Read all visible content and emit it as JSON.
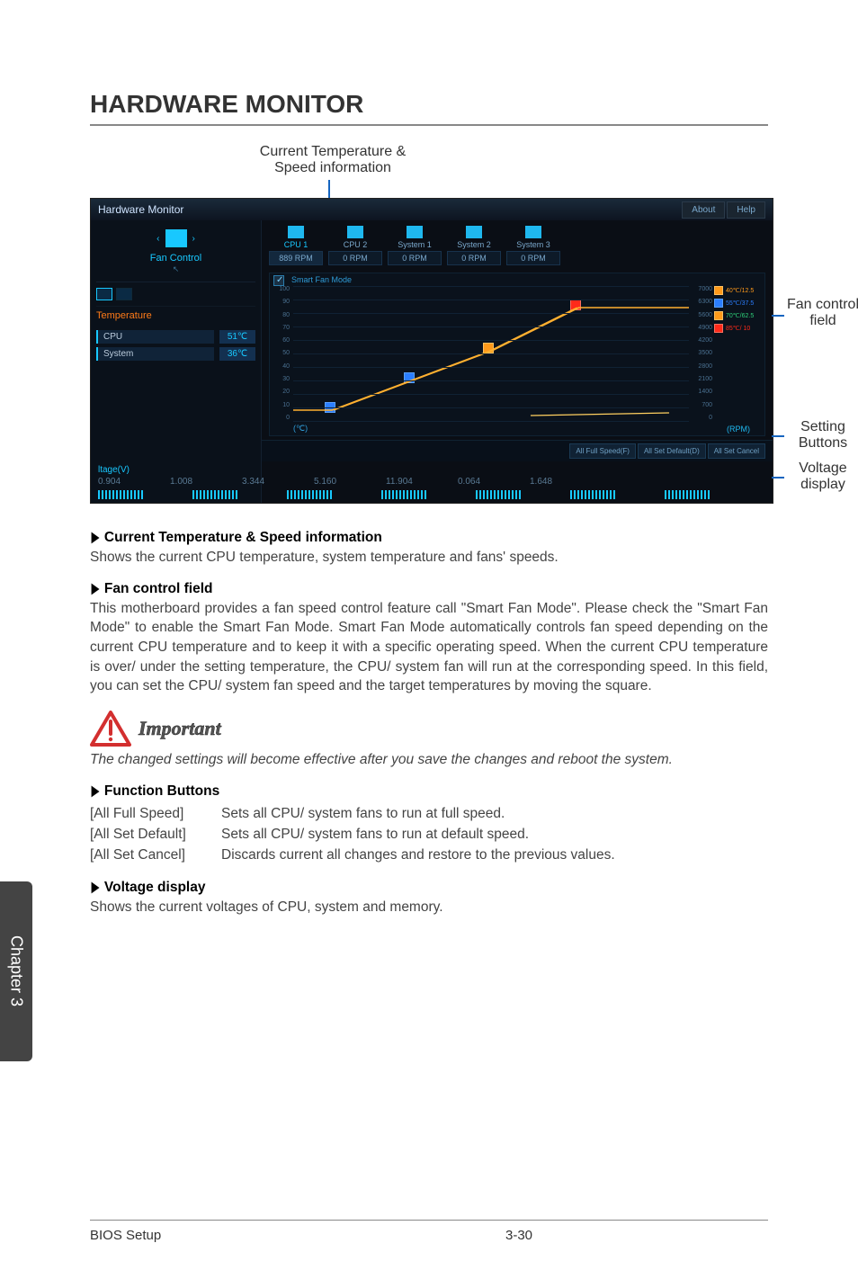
{
  "title": "HARDWARE MONITOR",
  "callout_top": "Current Temperature & Speed information",
  "annotations": {
    "fan_control_field": "Fan control field",
    "setting_buttons": "Setting Buttons",
    "voltage_display": "Voltage display"
  },
  "screenshot": {
    "window_title": "Hardware Monitor",
    "tabs": {
      "about": "About",
      "help": "Help"
    },
    "left": {
      "fan_control": "Fan Control",
      "temperature_label": "Temperature",
      "cpu": {
        "name": "CPU",
        "val": "51℃"
      },
      "system": {
        "name": "System",
        "val": "36℃"
      }
    },
    "fans": [
      {
        "name": "CPU 1",
        "val": "889 RPM",
        "sel": true
      },
      {
        "name": "CPU 2",
        "val": "0 RPM",
        "sel": false
      },
      {
        "name": "System 1",
        "val": "0 RPM",
        "sel": false
      },
      {
        "name": "System 2",
        "val": "0 RPM",
        "sel": false
      },
      {
        "name": "System 3",
        "val": "0 RPM",
        "sel": false
      }
    ],
    "chart": {
      "mode_label": "Smart Fan Mode",
      "y_left": [
        "100",
        "90",
        "80",
        "70",
        "60",
        "50",
        "40",
        "30",
        "20",
        "10",
        "0"
      ],
      "y_right": [
        "7000",
        "6300",
        "5600",
        "4900",
        "4200",
        "3500",
        "2800",
        "2100",
        "1400",
        "700",
        "0"
      ],
      "xlabel": "(℃)",
      "xlabel2": "(RPM)",
      "legend": [
        {
          "color": "lg-o",
          "sq": "sq-orange",
          "text": "40℃/12.5"
        },
        {
          "color": "lg-b",
          "sq": "sq-blue",
          "text": "55℃/37.5"
        },
        {
          "color": "lg-g",
          "sq": "sq-orange",
          "text": "70℃/62.5"
        },
        {
          "color": "lg-r",
          "sq": "sq-red",
          "text": "85℃/ 10"
        }
      ]
    },
    "buttons": {
      "full": "All Full Speed(F)",
      "def": "All Set Default(D)",
      "cancel": "All Set Cancel"
    },
    "voltage": {
      "label": "ltage(V)",
      "vals": [
        "0.904",
        "1.008",
        "3.344",
        "5.160",
        "11.904",
        "0.064",
        "1.648"
      ]
    }
  },
  "sections": {
    "s1_head": "Current Temperature & Speed information",
    "s1_body": "Shows the current CPU temperature, system temperature and fans' speeds.",
    "s2_head": "Fan control field",
    "s2_body": "This motherboard provides a fan speed control feature call \"Smart Fan Mode\". Please check the \"Smart Fan Mode\" to enable the Smart Fan Mode. Smart Fan Mode automatically controls fan speed depending on the current CPU temperature and to keep it with a specific operating speed. When the current CPU temperature is over/ under the setting temperature, the CPU/ system fan will run at the corresponding speed. In this field, you can set the CPU/ system fan speed and the target temperatures by moving the square.",
    "important_word": "Important",
    "important_note": "The changed settings will become effective after you save the changes and reboot the system.",
    "s3_head": "Function Buttons",
    "functions": [
      {
        "label": "[All Full Speed]",
        "desc": "Sets all CPU/ system fans to run at full speed."
      },
      {
        "label": "[All Set Default]",
        "desc": "Sets all CPU/ system fans to run at default speed."
      },
      {
        "label": "[All Set Cancel]",
        "desc": "Discards current all changes and restore to the previous values."
      }
    ],
    "s4_head": "Voltage display",
    "s4_body": "Shows the current voltages of CPU, system and memory."
  },
  "side_tab": "Chapter 3",
  "footer": {
    "left": "BIOS Setup",
    "mid": "3-30"
  }
}
